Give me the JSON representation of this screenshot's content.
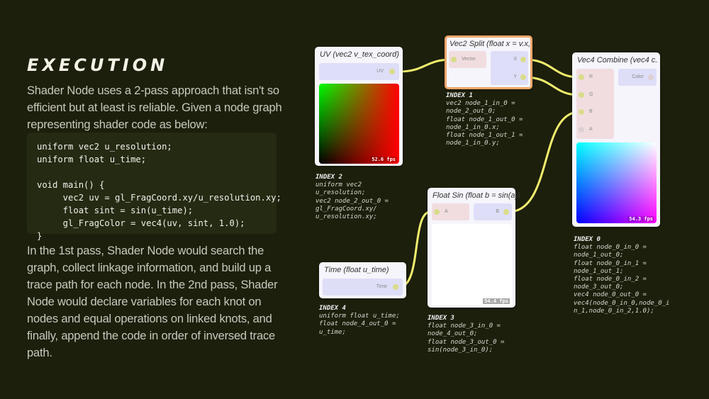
{
  "heading": "EXECUTION",
  "intro": "Shader Node uses a 2-pass approach that isn't so efficient but at least is reliable. Given a node graph representing shader code as below:",
  "code": "uniform vec2 u_resolution;\nuniform float u_time;\n\nvoid main() {\n     vec2 uv = gl_FragCoord.xy/u_resolution.xy;\n     float sint = sin(u_time);\n     gl_FragColor = vec4(uv, sint, 1.0);\n}",
  "explanation": "In the 1st pass, Shader Node would search the graph, collect linkage information, and build up a trace path for each node. In the 2nd pass, Shader Node would declare variables for each knot on nodes and equal operations on linked knots, and finally, append the code in order of inversed trace path.",
  "wire_color": "#f2ee6e",
  "nodes": {
    "uv": {
      "title": "UV (vec2 v_tex_coord)",
      "out": "UV",
      "fps": "52.6 fps",
      "index_label": "INDEX 2",
      "index_code": "uniform vec2\nu_resolution;\nvec2 node_2_out_0 =\ngl_FragCoord.xy/\nu_resolution.xy;"
    },
    "split": {
      "title": "Vec2 Split (float x = v.x,...",
      "in": "Vector",
      "out_x": "X",
      "out_y": "Y",
      "index_label": "INDEX 1",
      "index_code": "vec2 node_1_in_0 =\nnode_2_out_0;\nfloat node_1_out_0 =\nnode_1_in_0.x;\nfloat node_1_out_1 =\nnode_1_in_0.y;"
    },
    "combine": {
      "title": "Vec4 Combine (vec4 c...",
      "in_r": "R",
      "in_g": "G",
      "in_b": "B",
      "in_a": "A",
      "out": "Color",
      "fps": "54.3 fps",
      "index_label": "INDEX 0",
      "index_code": "float node_0_in_0 =\nnode_1_out_0;\nfloat node_0_in_1 =\nnode_1_out_1;\nfloat node_0_in_2 =\nnode_3_out_0;\nvec4 node_0_out_0 =\nvec4(node_0_in_0,node_0_i\nn_1,node_0_in_2,1.0);"
    },
    "sin": {
      "title": "Float Sin (float b = sin(a))",
      "in": "A",
      "out": "B",
      "fps": "54.4 fps",
      "index_label": "INDEX 3",
      "index_code": "float node_3_in_0 =\nnode_4_out_0;\nfloat node_3_out_0 =\nsin(node_3_in_0);"
    },
    "time": {
      "title": "Time (float u_time)",
      "out": "Time",
      "index_label": "INDEX 4",
      "index_code": "uniform float u_time;\nfloat node_4_out_0 =\nu_time;"
    }
  }
}
